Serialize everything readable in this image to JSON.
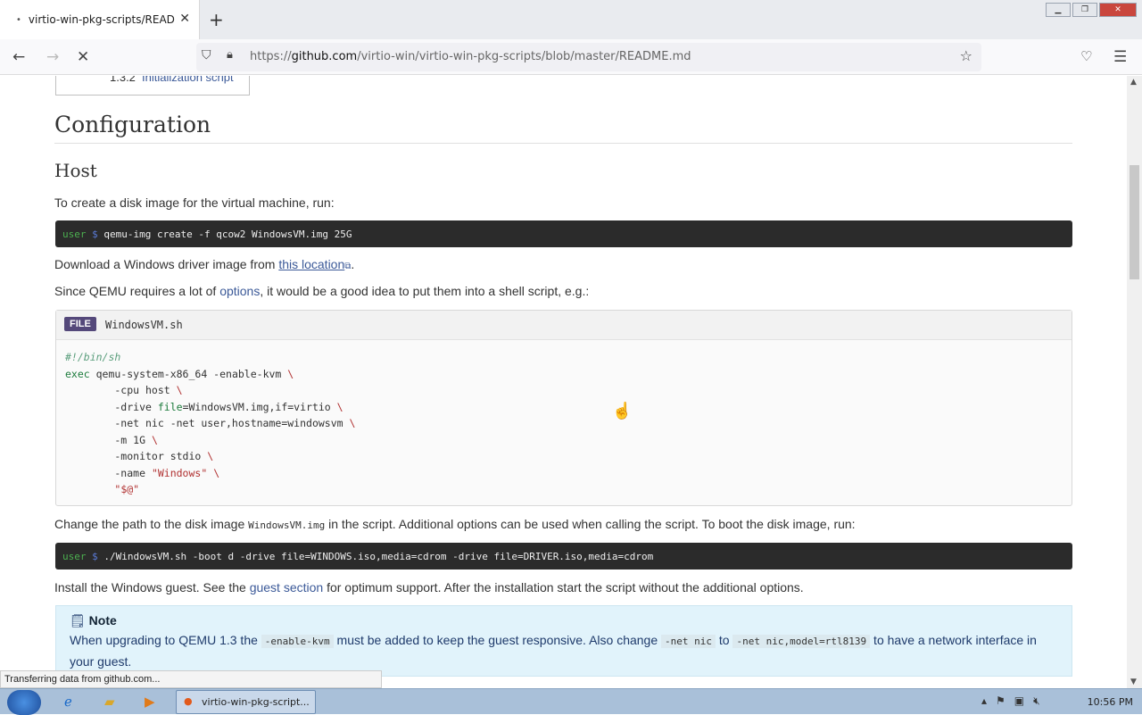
{
  "browser": {
    "tab_title": "virtio-win-pkg-scripts/READMI",
    "new_tab": "+",
    "url_host": "github.com",
    "url_prefix": "https://",
    "url_path": "/virtio-win/virtio-win-pkg-scripts/blob/master/README.md"
  },
  "toc": {
    "number": "1.3.2",
    "label": "Initialization script"
  },
  "page": {
    "heading": "Configuration",
    "subheading": "Host",
    "p_create": "To create a disk image for the virtual machine, run:",
    "cmd1_user": "user",
    "cmd1_prompt": "$",
    "cmd1_text": "qemu-img create -f qcow2 WindowsVM.img 25G",
    "p_download_before": "Download a Windows driver image from ",
    "p_download_link": "this location",
    "p_download_after": ".",
    "p_qemu_before": "Since QEMU requires a lot of ",
    "p_qemu_link": "options",
    "p_qemu_after": ", it would be a good idea to put them into a shell script, e.g.:",
    "file_tag": "FILE",
    "file_name": "WindowsVM.sh",
    "p_change_before": "Change the path to the disk image ",
    "p_change_code": "WindowsVM.img",
    "p_change_after": " in the script. Additional options can be used when calling the script. To boot the disk image, run:",
    "cmd2_user": "user",
    "cmd2_prompt": "$",
    "cmd2_text": "./WindowsVM.sh -boot d -drive file=WINDOWS.iso,media=cdrom -drive file=DRIVER.iso,media=cdrom",
    "p_install_before": "Install the Windows guest. See the ",
    "p_install_link": "guest section",
    "p_install_after": " for optimum support. After the installation start the script without the additional options.",
    "note_title": "Note",
    "note_t1": "When upgrading to QEMU 1.3 the ",
    "note_c1": "-enable-kvm",
    "note_t2": " must be added to keep the guest responsive. Also change ",
    "note_c2": "-net nic",
    "note_t3": " to ",
    "note_c3": "-net nic,model=rtl8139",
    "note_t4": " to have a network interface in your guest."
  },
  "status": "Transferring data from github.com...",
  "taskbar": {
    "task_label": "virtio-win-pkg-script...",
    "clock": "10:56 PM"
  }
}
